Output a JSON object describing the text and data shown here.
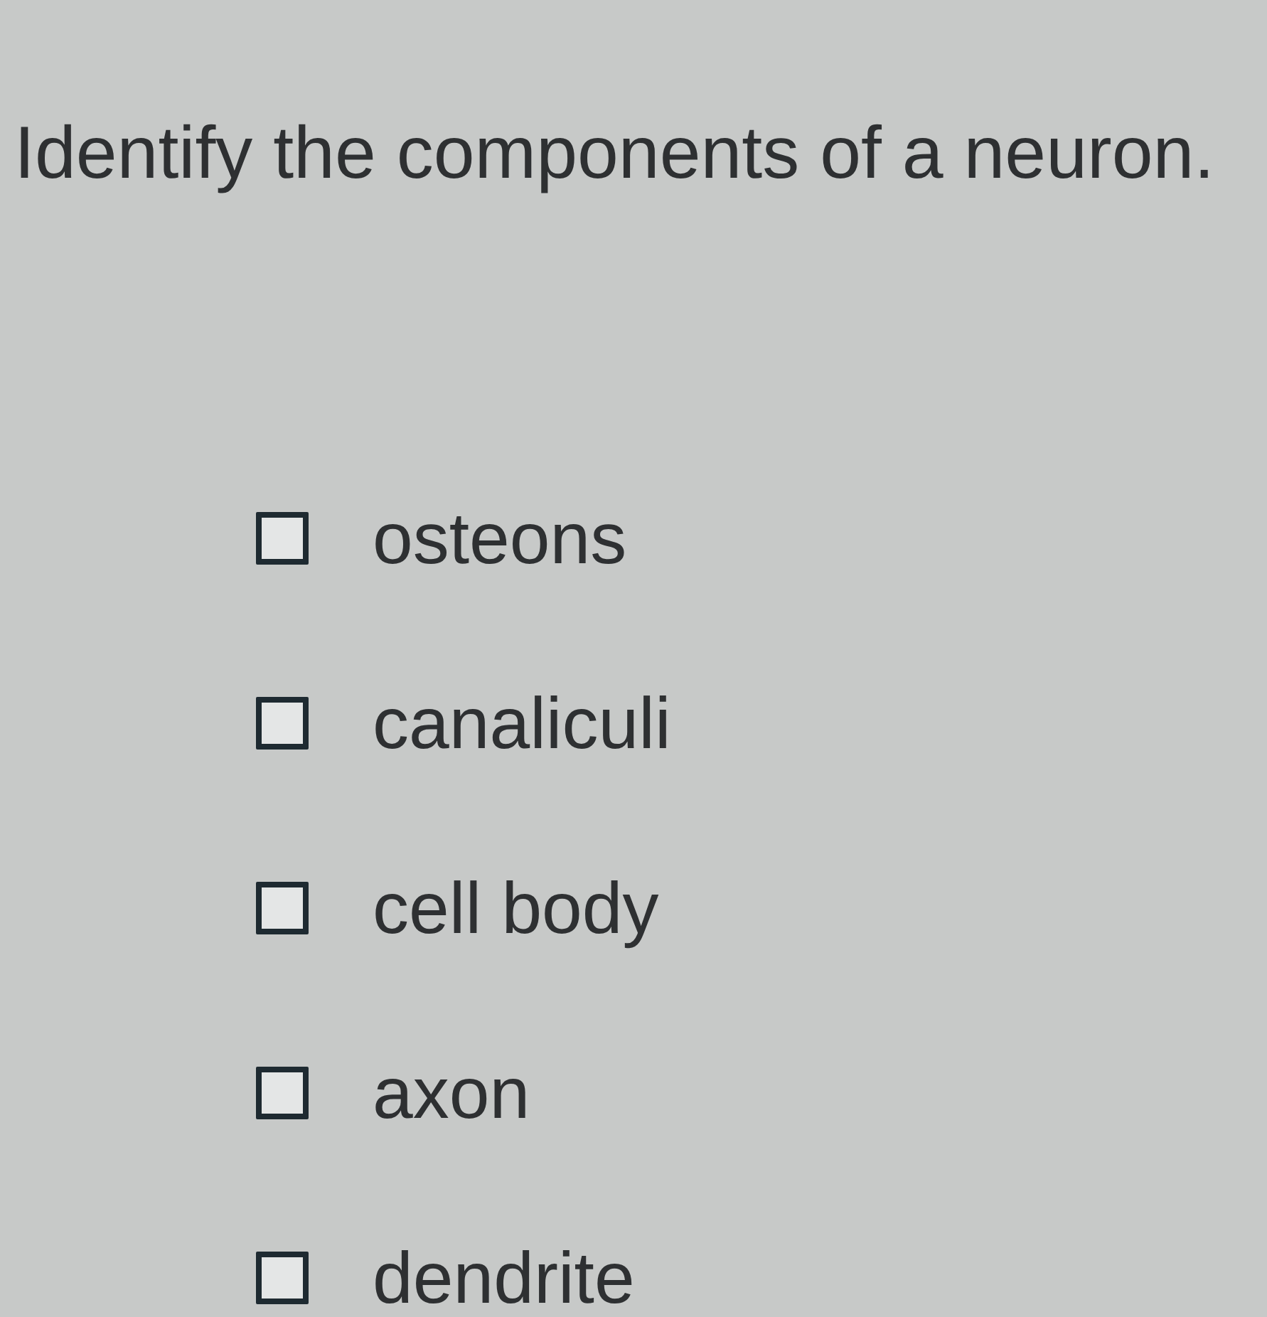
{
  "question": "Identify the components of a neuron.",
  "options": [
    {
      "label": "osteons",
      "checked": false
    },
    {
      "label": "canaliculi",
      "checked": false
    },
    {
      "label": "cell body",
      "checked": false
    },
    {
      "label": "axon",
      "checked": false
    },
    {
      "label": "dendrite",
      "checked": false
    }
  ]
}
